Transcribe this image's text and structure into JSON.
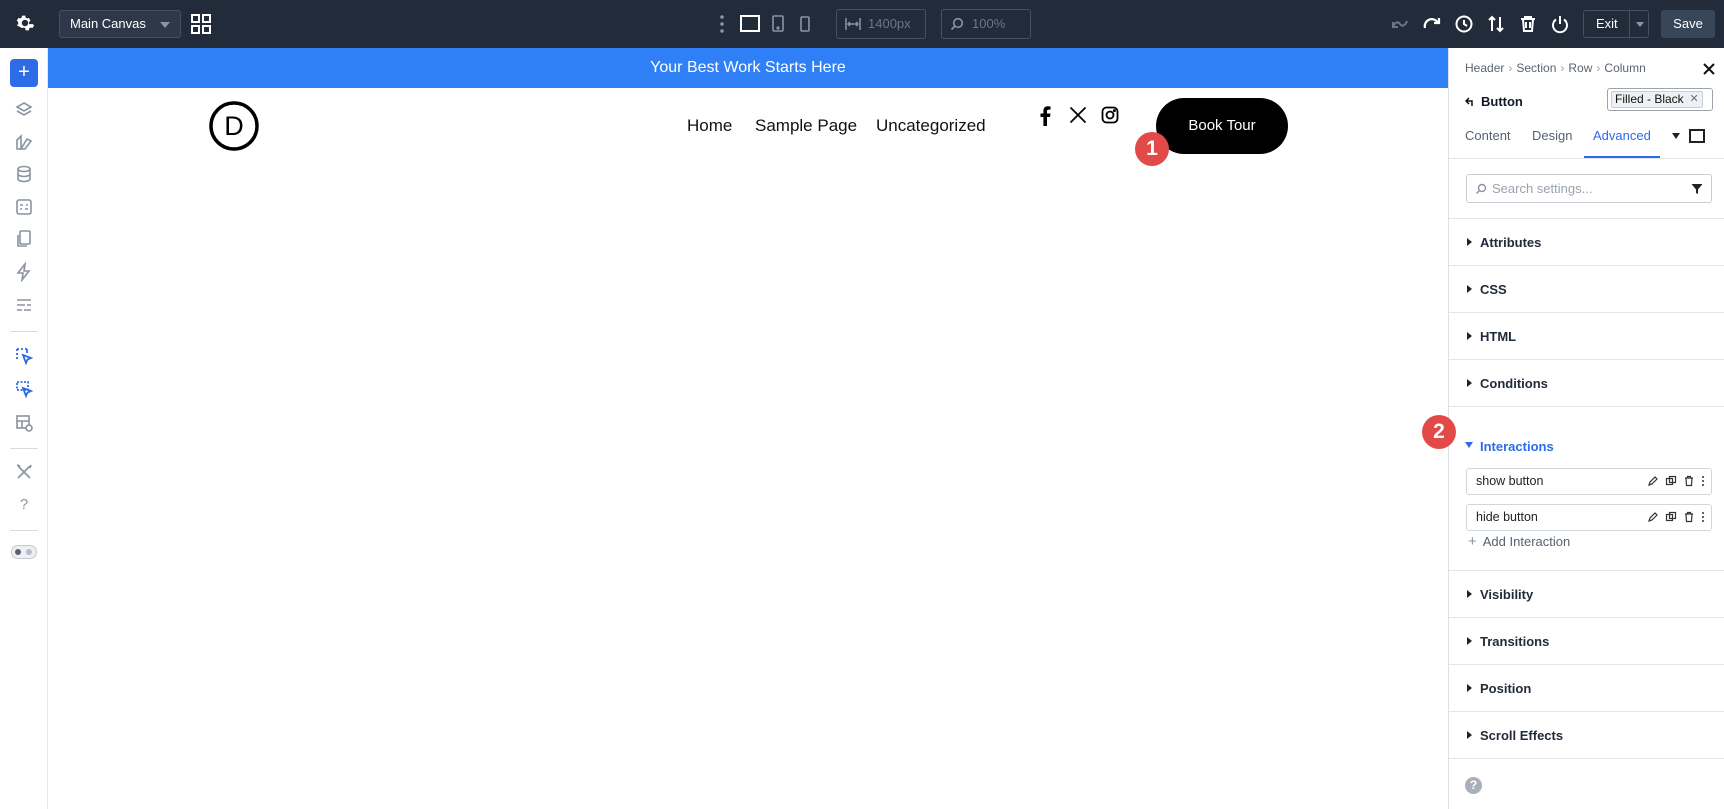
{
  "topbar": {
    "canvas_name": "Main Canvas",
    "width_value": "1400px",
    "zoom_value": "100%",
    "exit_label": "Exit",
    "save_label": "Save"
  },
  "canvas": {
    "banner_text": "Your Best Work Starts Here",
    "logo_letter": "D",
    "nav": [
      "Home",
      "Sample Page",
      "Uncategorized"
    ],
    "book_button": "Book Tour",
    "markers": [
      "1",
      "2"
    ]
  },
  "panel": {
    "breadcrumb": [
      "Header",
      "Section",
      "Row",
      "Column"
    ],
    "module_name": "Button",
    "preset": "Filled - Black",
    "tabs": [
      "Content",
      "Design",
      "Advanced"
    ],
    "search_placeholder": "Search settings...",
    "sections_top": [
      "Attributes",
      "CSS",
      "HTML",
      "Conditions"
    ],
    "interactions_label": "Interactions",
    "interactions": [
      "show button",
      "hide button"
    ],
    "add_interaction": "Add Interaction",
    "sections_bottom": [
      "Visibility",
      "Transitions",
      "Position",
      "Scroll Effects"
    ],
    "help_glyph": "?"
  },
  "colors": {
    "topbar_bg": "#222b3a",
    "accent": "#2e6be6",
    "banner": "#2f80f7",
    "marker": "#e24a4a"
  }
}
